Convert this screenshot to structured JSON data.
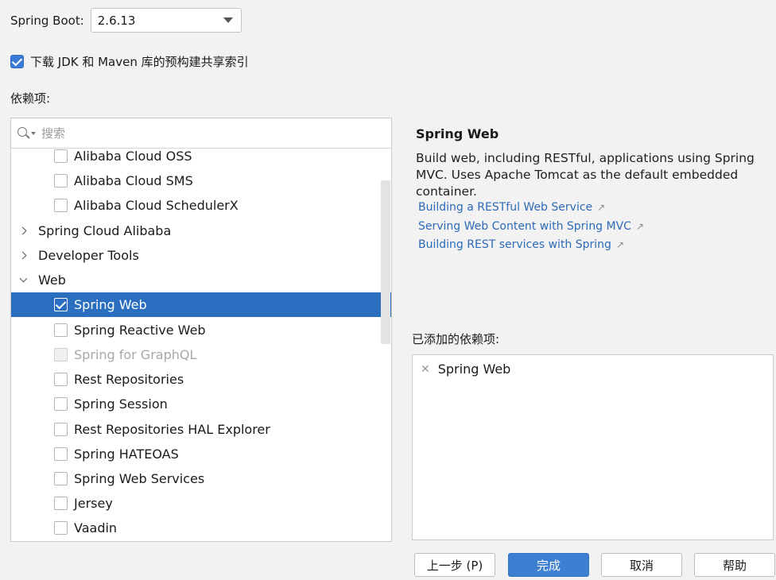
{
  "spring_boot": {
    "label": "Spring Boot:",
    "version": "2.6.13"
  },
  "jdk_index": {
    "label": "下载 JDK 和 Maven 库的预构建共享索引",
    "checked": true
  },
  "dependencies_label": "依赖项:",
  "search": {
    "placeholder": "搜索",
    "value": ""
  },
  "tree": [
    {
      "type": "checkbox",
      "label": "Alibaba Cloud OSS",
      "checked": false
    },
    {
      "type": "checkbox",
      "label": "Alibaba Cloud SMS",
      "checked": false
    },
    {
      "type": "checkbox",
      "label": "Alibaba Cloud SchedulerX",
      "checked": false
    },
    {
      "type": "group",
      "label": "Spring Cloud Alibaba",
      "expanded": false
    },
    {
      "type": "group",
      "label": "Developer Tools",
      "expanded": false
    },
    {
      "type": "group",
      "label": "Web",
      "expanded": true
    },
    {
      "type": "checkbox",
      "label": "Spring Web",
      "checked": true,
      "selected": true
    },
    {
      "type": "checkbox",
      "label": "Spring Reactive Web",
      "checked": false
    },
    {
      "type": "checkbox",
      "label": "Spring for GraphQL",
      "checked": false,
      "disabled": true
    },
    {
      "type": "checkbox",
      "label": "Rest Repositories",
      "checked": false
    },
    {
      "type": "checkbox",
      "label": "Spring Session",
      "checked": false
    },
    {
      "type": "checkbox",
      "label": "Rest Repositories HAL Explorer",
      "checked": false
    },
    {
      "type": "checkbox",
      "label": "Spring HATEOAS",
      "checked": false
    },
    {
      "type": "checkbox",
      "label": "Spring Web Services",
      "checked": false
    },
    {
      "type": "checkbox",
      "label": "Jersey",
      "checked": false
    },
    {
      "type": "checkbox",
      "label": "Vaadin",
      "checked": false
    }
  ],
  "detail": {
    "title": "Spring Web",
    "description": "Build web, including RESTful, applications using Spring MVC. Uses Apache Tomcat as the default embedded container.",
    "links": [
      "Building a RESTful Web Service",
      "Serving Web Content with Spring MVC",
      "Building REST services with Spring"
    ]
  },
  "added": {
    "label": "已添加的依赖项:",
    "items": [
      "Spring Web"
    ]
  },
  "buttons": {
    "previous": "上一步 (P)",
    "finish": "完成",
    "cancel": "取消",
    "help": "帮助"
  },
  "colors": {
    "accent": "#2a6fbf",
    "link": "#2d6bb8",
    "primary_button": "#3d7fd1"
  },
  "icons": {
    "external_link": "↗",
    "remove": "✕"
  }
}
